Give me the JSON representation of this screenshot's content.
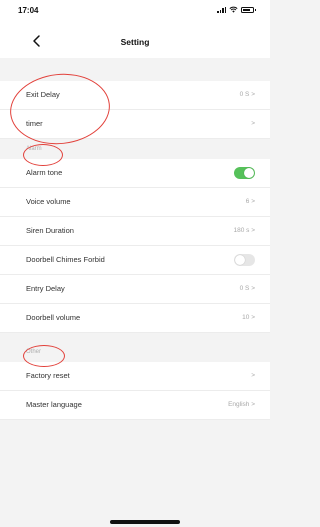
{
  "status_bar": {
    "time": "17:04"
  },
  "header": {
    "title": "Setting"
  },
  "general": {
    "exit_delay": {
      "label": "Exit Delay",
      "value": "0 S >"
    },
    "timer": {
      "label": "timer",
      "value": ">"
    }
  },
  "alarm_section": {
    "title": "Alarm",
    "alarm_tone": {
      "label": "Alarm tone",
      "enabled": true
    },
    "voice_volume": {
      "label": "Voice volume",
      "value": "6 >"
    },
    "siren_duration": {
      "label": "Siren Duration",
      "value": "180 s >"
    },
    "doorbell_chimes_forbid": {
      "label": "Doorbell Chimes Forbid",
      "enabled": false
    },
    "entry_delay": {
      "label": "Entry Delay",
      "value": "0 S >"
    },
    "doorbell_volume": {
      "label": "Doorbell volume",
      "value": "10 >"
    }
  },
  "other_section": {
    "title": "Other",
    "factory_reset": {
      "label": "Factory reset",
      "value": ">"
    },
    "master_language": {
      "label": "Master language",
      "value": "English >"
    }
  },
  "colors": {
    "toggle_on": "#56c15a",
    "toggle_off": "#e6e6e6",
    "annotation": "#e2403a"
  }
}
